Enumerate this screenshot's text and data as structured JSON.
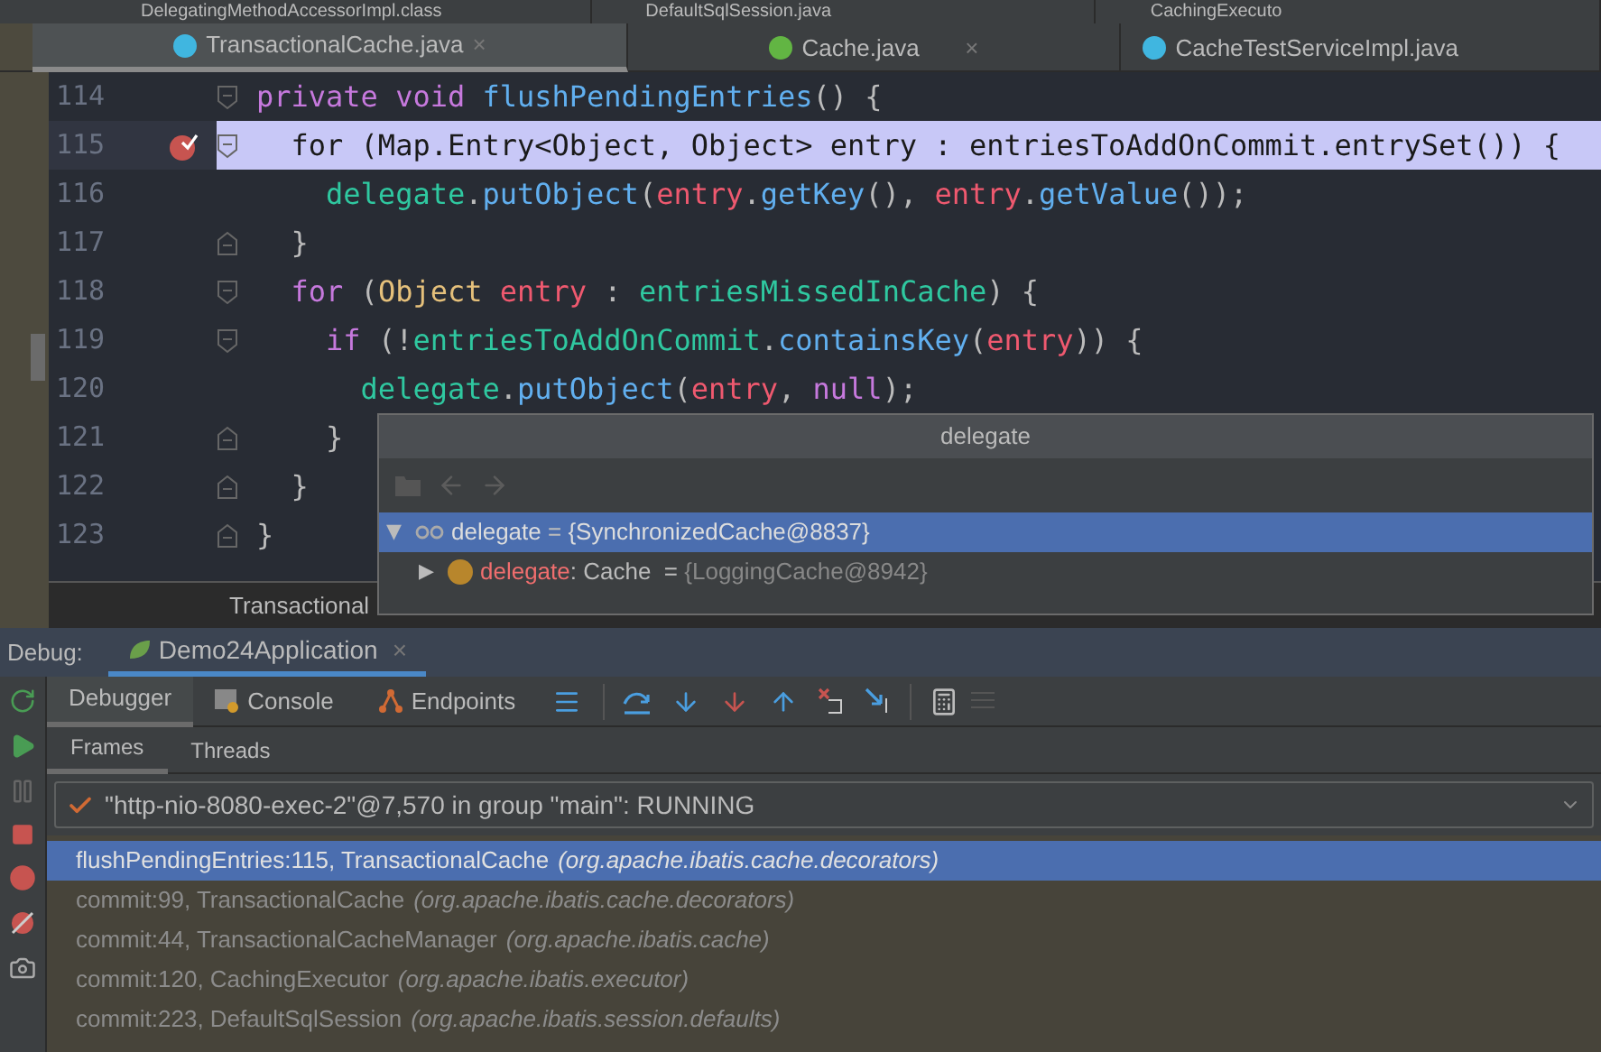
{
  "top_tabs": [
    {
      "label": "DelegatingMethodAccessorImpl.class"
    },
    {
      "label": "DefaultSqlSession.java"
    },
    {
      "label": "CachingExecuto"
    }
  ],
  "editor_tabs": [
    {
      "label": "TransactionalCache.java",
      "kind": "class",
      "selected": true,
      "close": "×"
    },
    {
      "label": "Cache.java",
      "kind": "interface",
      "selected": false,
      "close": "×"
    },
    {
      "label": "CacheTestServiceImpl.java",
      "kind": "class",
      "selected": false
    }
  ],
  "code": [
    {
      "number": "114",
      "current": false,
      "breakpoint": false,
      "fold": {
        "kind": "start"
      },
      "tokens": [
        {
          "t": "private void ",
          "kind": "kw"
        },
        {
          "t": "flushPendingEntries",
          "kind": "method"
        },
        {
          "t": "() {",
          "kind": "plain"
        }
      ]
    },
    {
      "number": "115",
      "current": true,
      "breakpoint": true,
      "fold": {
        "kind": "start"
      },
      "tokens": [
        {
          "t": "  for (Map.Entry<Object, Object> entry : entriesToAddOnCommit.entrySet()) {"
        }
      ]
    },
    {
      "number": "116",
      "current": false,
      "breakpoint": false,
      "fold": {
        "kind": "none"
      },
      "tokens": [
        {
          "t": "    delegate",
          "kind": "field"
        },
        {
          "t": ".",
          "kind": "plain"
        },
        {
          "t": "putObject",
          "kind": "method"
        },
        {
          "t": "(",
          "kind": "plain"
        },
        {
          "t": "entry",
          "kind": "var"
        },
        {
          "t": ".",
          "kind": "plain"
        },
        {
          "t": "getKey",
          "kind": "method"
        },
        {
          "t": "(), ",
          "kind": "plain"
        },
        {
          "t": "entry",
          "kind": "var"
        },
        {
          "t": ".",
          "kind": "plain"
        },
        {
          "t": "getValue",
          "kind": "method"
        },
        {
          "t": "());",
          "kind": "plain"
        }
      ]
    },
    {
      "number": "117",
      "current": false,
      "breakpoint": false,
      "fold": {
        "kind": "end"
      },
      "tokens": [
        {
          "t": "  }",
          "kind": "plain"
        }
      ]
    },
    {
      "number": "118",
      "current": false,
      "breakpoint": false,
      "fold": {
        "kind": "start"
      },
      "tokens": [
        {
          "t": "  for ",
          "kind": "kw"
        },
        {
          "t": "(",
          "kind": "plain"
        },
        {
          "t": "Object ",
          "kind": "type"
        },
        {
          "t": "entry",
          "kind": "var"
        },
        {
          "t": " : ",
          "kind": "plain"
        },
        {
          "t": "entriesMissedInCache",
          "kind": "field"
        },
        {
          "t": ") {",
          "kind": "plain"
        }
      ]
    },
    {
      "number": "119",
      "current": false,
      "breakpoint": false,
      "fold": {
        "kind": "start"
      },
      "tokens": [
        {
          "t": "    if ",
          "kind": "kw"
        },
        {
          "t": "(!",
          "kind": "plain"
        },
        {
          "t": "entriesToAddOnCommit",
          "kind": "field"
        },
        {
          "t": ".",
          "kind": "plain"
        },
        {
          "t": "containsKey",
          "kind": "method"
        },
        {
          "t": "(",
          "kind": "plain"
        },
        {
          "t": "entry",
          "kind": "var"
        },
        {
          "t": ")) {",
          "kind": "plain"
        }
      ]
    },
    {
      "number": "120",
      "current": false,
      "breakpoint": false,
      "fold": {
        "kind": "none"
      },
      "tokens": [
        {
          "t": "      delegate",
          "kind": "field"
        },
        {
          "t": ".",
          "kind": "plain"
        },
        {
          "t": "putObject",
          "kind": "method"
        },
        {
          "t": "(",
          "kind": "plain"
        },
        {
          "t": "entry",
          "kind": "var"
        },
        {
          "t": ", ",
          "kind": "plain"
        },
        {
          "t": "null",
          "kind": "kw"
        },
        {
          "t": ");",
          "kind": "plain"
        }
      ]
    },
    {
      "number": "121",
      "current": false,
      "breakpoint": false,
      "fold": {
        "kind": "end"
      },
      "tokens": [
        {
          "t": "    }",
          "kind": "plain"
        }
      ]
    },
    {
      "number": "122",
      "current": false,
      "breakpoint": false,
      "fold": {
        "kind": "end"
      },
      "tokens": [
        {
          "t": "  }",
          "kind": "plain"
        }
      ]
    },
    {
      "number": "123",
      "current": false,
      "breakpoint": false,
      "fold": {
        "kind": "end"
      },
      "tokens": [
        {
          "t": "}",
          "kind": "plain"
        }
      ]
    }
  ],
  "breadcrumb": "Transactional",
  "popup": {
    "title": "delegate",
    "rows": [
      {
        "kind": "watch",
        "toggle": "▼",
        "selected": true,
        "name": "delegate",
        "sep": " = ",
        "value": "{SynchronizedCache@8837}"
      },
      {
        "kind": "field",
        "toggle": "▶",
        "selected": false,
        "name": "delegate",
        "type": ": Cache",
        "sep": "  = ",
        "value": "{LoggingCache@8942}"
      }
    ]
  },
  "debug": {
    "label": "Debug:",
    "session": "Demo24Application",
    "close": "×",
    "tabs": [
      {
        "label": "Debugger",
        "kind": "plain",
        "selected": true
      },
      {
        "label": "Console",
        "kind": "console",
        "selected": false
      },
      {
        "label": "Endpoints",
        "kind": "endpoints",
        "selected": false
      }
    ],
    "subtabs": [
      {
        "label": "Frames",
        "selected": true
      },
      {
        "label": "Threads",
        "selected": false
      }
    ],
    "thread": "\"http-nio-8080-exec-2\"@7,570 in group \"main\": RUNNING",
    "frames": [
      {
        "method": "flushPendingEntries:115, TransactionalCache",
        "package": "(org.apache.ibatis.cache.decorators)",
        "selected": true
      },
      {
        "method": "commit:99, TransactionalCache",
        "package": "(org.apache.ibatis.cache.decorators)",
        "selected": false
      },
      {
        "method": "commit:44, TransactionalCacheManager",
        "package": "(org.apache.ibatis.cache)",
        "selected": false
      },
      {
        "method": "commit:120, CachingExecutor",
        "package": "(org.apache.ibatis.executor)",
        "selected": false
      },
      {
        "method": "commit:223, DefaultSqlSession",
        "package": "(org.apache.ibatis.session.defaults)",
        "selected": false
      }
    ]
  }
}
